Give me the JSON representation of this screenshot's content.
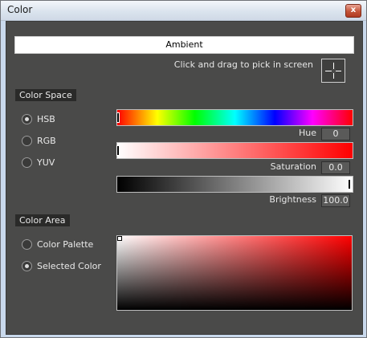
{
  "window": {
    "title": "Color",
    "close_glyph": "x"
  },
  "ambient_label": "Ambient",
  "pick_hint": "Click and drag to pick in screen",
  "color_space": {
    "heading": "Color Space",
    "options": [
      {
        "label": "HSB",
        "selected": true
      },
      {
        "label": "RGB",
        "selected": false
      },
      {
        "label": "YUV",
        "selected": false
      }
    ]
  },
  "sliders": {
    "hue": {
      "label": "Hue",
      "value": "0"
    },
    "saturation": {
      "label": "Saturation",
      "value": "0.0"
    },
    "brightness": {
      "label": "Brightness",
      "value": "100.0"
    }
  },
  "color_area": {
    "heading": "Color Area",
    "options": [
      {
        "label": "Color Palette",
        "selected": false
      },
      {
        "label": "Selected Color",
        "selected": true
      }
    ]
  },
  "colors": {
    "panel_bg": "#4a4a49",
    "section_bg": "#2a2a29",
    "base_hue": "#ff0000"
  },
  "icons": {
    "picker": "crosshair-icon",
    "close": "close-icon"
  }
}
